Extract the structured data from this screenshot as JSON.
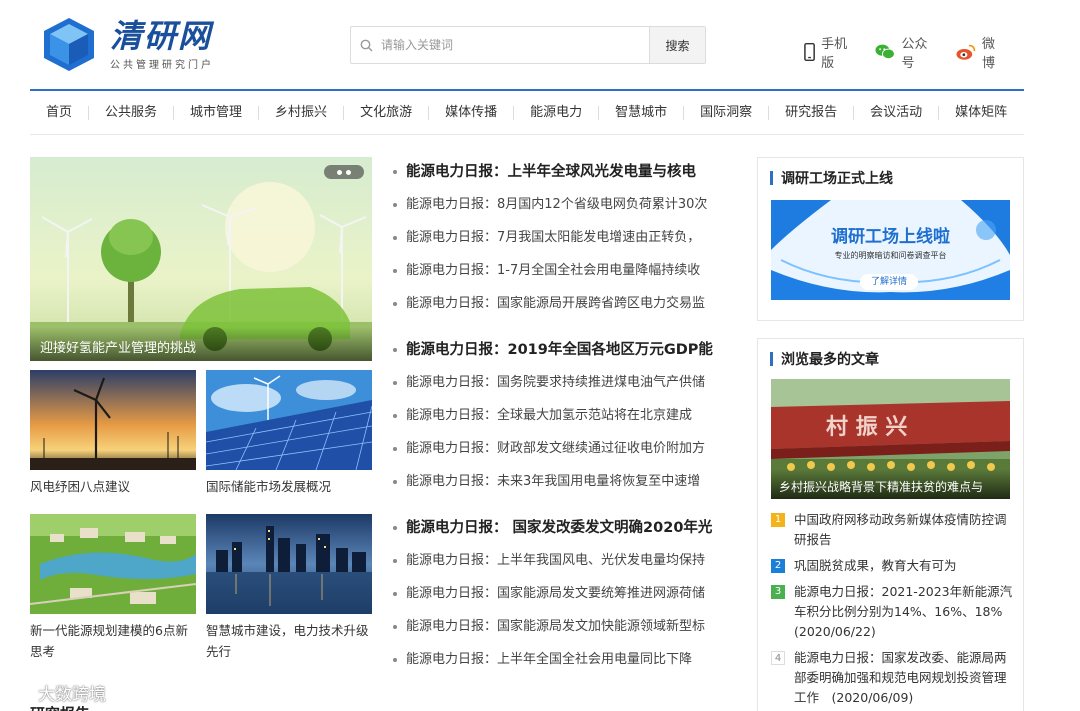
{
  "header": {
    "logo_title": "清研网",
    "logo_subtitle": "公共管理研究门户",
    "search_placeholder": "请输入关键词",
    "search_button": "搜索",
    "links": [
      {
        "label": "手机版",
        "icon": "phone-icon"
      },
      {
        "label": "公众号",
        "icon": "wechat-icon"
      },
      {
        "label": "微博",
        "icon": "weibo-icon"
      }
    ],
    "accent_color": "#2f6fc6"
  },
  "nav": [
    "首页",
    "公共服务",
    "城市管理",
    "乡村振兴",
    "文化旅游",
    "媒体传播",
    "能源电力",
    "智慧城市",
    "国际洞察",
    "研究报告",
    "会议活动",
    "媒体矩阵"
  ],
  "hero": {
    "caption": "迎接好氢能产业管理的挑战"
  },
  "thumbs": [
    {
      "caption": "风电纾困八点建议"
    },
    {
      "caption": "国际储能市场发展概况"
    },
    {
      "caption": "新一代能源规划建模的6点新思考"
    },
    {
      "caption": "智慧城市建设，电力技术升级先行"
    }
  ],
  "news_blocks": [
    {
      "headline": "能源电力日报：上半年全球风光发电量与核电",
      "items": [
        "能源电力日报：8月国内12个省级电网负荷累计30次",
        "能源电力日报：7月我国太阳能发电增速由正转负，",
        "能源电力日报：1-7月全国全社会用电量降幅持续收",
        "能源电力日报：国家能源局开展跨省跨区电力交易监"
      ]
    },
    {
      "headline": "能源电力日报：2019年全国各地区万元GDP能",
      "items": [
        "能源电力日报：国务院要求持续推进煤电油气产供储",
        "能源电力日报：全球最大加氢示范站将在北京建成",
        "能源电力日报：财政部发文继续通过征收电价附加方",
        "能源电力日报：未来3年我国用电量将恢复至中速增"
      ]
    },
    {
      "headline": "能源电力日报： 国家发改委发文明确2020年光",
      "items": [
        "能源电力日报：上半年我国风电、光伏发电量均保持",
        "能源电力日报：国家能源局发文要统筹推进网源荷储",
        "能源电力日报：国家能源局发文加快能源领域新型标",
        "能源电力日报：上半年全国全社会用电量同比下降"
      ]
    }
  ],
  "sidebar": {
    "survey": {
      "title": "调研工场正式上线",
      "banner_title": "调研工场上线啦",
      "banner_sub": "专业的明察暗访和问卷调查平台",
      "banner_button": "了解详情"
    },
    "popular": {
      "title": "浏览最多的文章",
      "image_caption": "乡村振兴战略背景下精准扶贫的难点与",
      "sign_text": "村 振 兴",
      "items": [
        {
          "rank": "1",
          "color": "#f5b31b",
          "text": "中国政府网移动政务新媒体疫情防控调研报告"
        },
        {
          "rank": "2",
          "color": "#1a7fd8",
          "text": "巩固脱贫成果，教育大有可为"
        },
        {
          "rank": "3",
          "color": "#4caf50",
          "text": "能源电力日报：2021-2023年新能源汽车积分比例分别为14%、16%、18%　(2020/06/22)"
        },
        {
          "rank": "4",
          "color": "#ffffff",
          "text": "能源电力日报：国家发改委、能源局两部委明确加强和规范电网规划投资管理工作　(2020/06/09)"
        }
      ]
    }
  },
  "section_peek": "研究报告",
  "watermark": "大数跨境"
}
